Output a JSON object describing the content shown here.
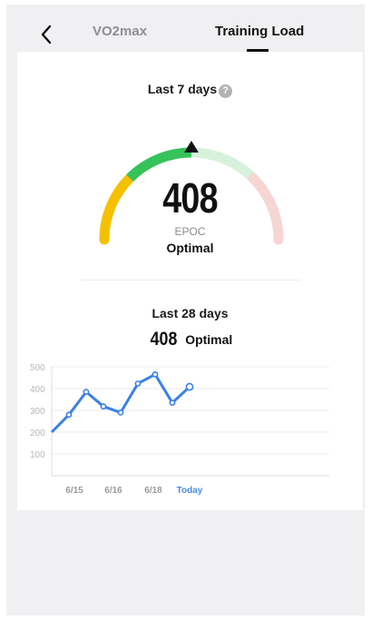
{
  "header": {
    "back_icon": "chevron-left-icon",
    "tabs": [
      {
        "label": "VO2max",
        "active": false
      },
      {
        "label": "Training Load",
        "active": true
      }
    ]
  },
  "last7": {
    "title": "Last 7 days",
    "help_icon": "question-circle-icon",
    "value": "408",
    "unit": "EPOC",
    "status": "Optimal"
  },
  "gauge": {
    "segments": [
      {
        "name": "low",
        "color": "#f5c000"
      },
      {
        "name": "optimal",
        "color": "#36c35a"
      },
      {
        "name": "high",
        "color": "#d6f2dc"
      },
      {
        "name": "overreaching",
        "color": "#f6d5d2"
      }
    ],
    "pointer_level": 0.5
  },
  "last28": {
    "title": "Last 28 days",
    "value": "408",
    "status": "Optimal"
  },
  "chart_data": {
    "type": "line",
    "x": [
      "6/14",
      "6/14.5",
      "6/15",
      "6/15.5",
      "6/16",
      "6/16.5",
      "6/17",
      "6/17.5",
      "6/18",
      "Today"
    ],
    "x_tick_labels": [
      "6/15",
      "6/16",
      "6/18",
      "Today"
    ],
    "y_tick_labels": [
      "500",
      "400",
      "300",
      "200",
      "100"
    ],
    "ylim": [
      0,
      500
    ],
    "series": [
      {
        "values": [
          200,
          280,
          385,
          318,
          290,
          423,
          465,
          335,
          408
        ],
        "color": "#3a80e8"
      }
    ],
    "grid": true
  }
}
